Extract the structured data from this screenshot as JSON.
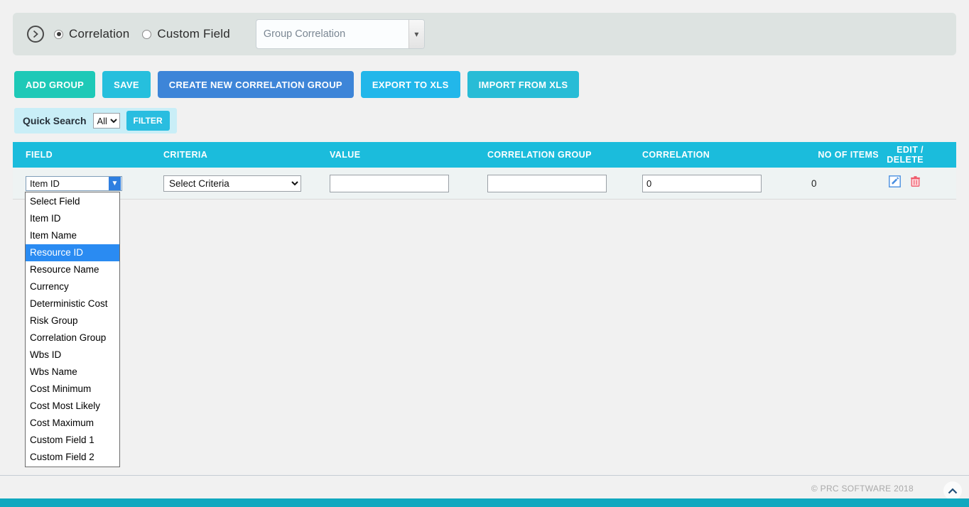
{
  "header": {
    "expand_icon": "circle-chevron-right-icon",
    "radios": [
      {
        "label": "Correlation",
        "selected": true
      },
      {
        "label": "Custom Field",
        "selected": false
      }
    ],
    "group_select": {
      "value": "Group Correlation",
      "options": [
        "Group Correlation"
      ],
      "arrow_icon": "chevron-down-icon"
    }
  },
  "toolbar": {
    "buttons": [
      {
        "label": "ADD GROUP",
        "color": "#1ec9b7"
      },
      {
        "label": "SAVE",
        "color": "#26bfdd"
      },
      {
        "label": "CREATE NEW CORRELATION GROUP",
        "color": "#3d85d8"
      },
      {
        "label": "EXPORT TO XLS",
        "color": "#22b7ea"
      },
      {
        "label": "IMPORT FROM XLS",
        "color": "#28bcd6"
      }
    ]
  },
  "quick_search": {
    "label": "Quick Search",
    "scope_value": "All",
    "scope_options": [
      "All"
    ],
    "filter_label": "FILTER"
  },
  "table": {
    "columns": [
      "FIELD",
      "CRITERIA",
      "VALUE",
      "CORRELATION GROUP",
      "CORRELATION",
      "NO OF ITEMS",
      "EDIT / DELETE"
    ],
    "rows": [
      {
        "field_value": "Item ID",
        "criteria_value": "Select Criteria",
        "value": "",
        "value_placeholder": "",
        "correlation_group": "",
        "correlation_group_placeholder": "",
        "correlation": "0",
        "no_of_items": "0",
        "edit_icon": "edit-pencil-icon",
        "delete_icon": "trash-icon"
      }
    ]
  },
  "field_dropdown": {
    "open": true,
    "highlighted": "Resource ID",
    "options": [
      "Select Field",
      "Item ID",
      "Item Name",
      "Resource ID",
      "Resource Name",
      "Currency",
      "Deterministic Cost",
      "Risk Group",
      "Correlation Group",
      "Wbs ID",
      "Wbs Name",
      "Cost Minimum",
      "Cost Most Likely",
      "Cost Maximum",
      "Custom Field 1",
      "Custom Field 2"
    ]
  },
  "criteria_dropdown": {
    "options": [
      "Select Criteria"
    ]
  },
  "footer": {
    "copyright": "© PRC SOFTWARE 2018",
    "scroll_top_icon": "chevron-up-icon"
  },
  "colors": {
    "accent": "#1bbcdc",
    "bottom_bar": "#11a8bf",
    "panel": "#dde3e1",
    "row": "#eef3f3",
    "highlight": "#2a8bf2"
  }
}
